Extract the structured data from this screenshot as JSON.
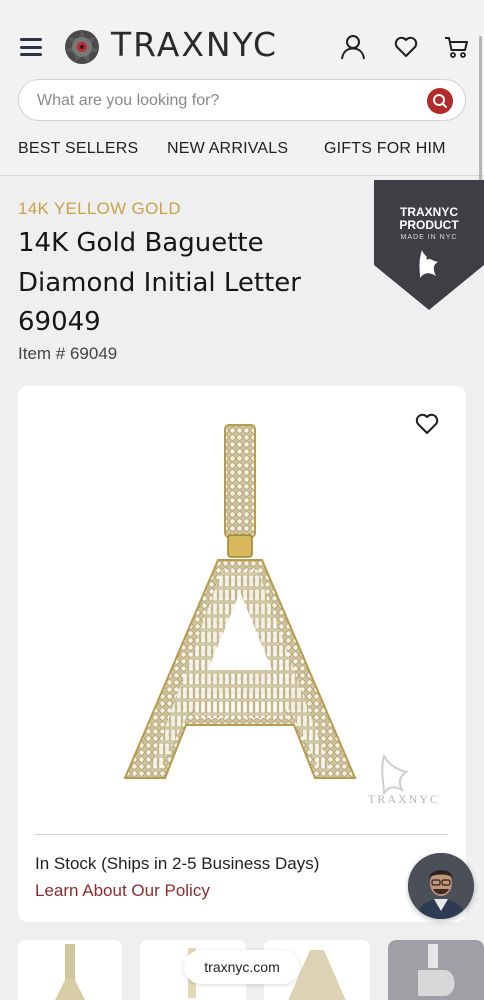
{
  "header": {
    "logo_text": "TRAXNYC",
    "search": {
      "placeholder": "What are you looking for?"
    },
    "nav": [
      "BEST SELLERS",
      "NEW ARRIVALS",
      "GIFTS FOR HIM"
    ]
  },
  "badge": {
    "line1": "TRAXNYC",
    "line2": "PRODUCT",
    "line3": "MADE IN NYC"
  },
  "product": {
    "category": "14K YELLOW GOLD",
    "title": "14K Gold Baguette Diamond Initial Letter 69049",
    "item_number": "Item # 69049",
    "stock_status": "In Stock (Ships in 2-5 Business Days)",
    "policy_link": "Learn About Our Policy",
    "watermark": "TRAXNYC"
  },
  "browser": {
    "url": "traxnyc.com"
  },
  "colors": {
    "accent_gold": "#c9a24a",
    "brand_red": "#b42a2a",
    "policy_link": "#8b2d2d",
    "badge_bg": "#3d3f44"
  }
}
